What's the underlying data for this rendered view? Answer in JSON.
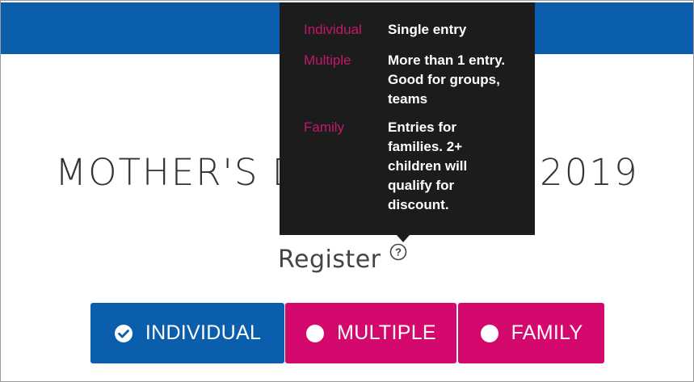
{
  "header": {
    "bar_color": "#0a5eab"
  },
  "event": {
    "title": "MOTHER'S DAY CLASSIC 2019"
  },
  "register": {
    "label": "Register",
    "help_icon": "question-circle-icon"
  },
  "tooltip": {
    "rows": [
      {
        "term": "Individual",
        "desc": "Single entry"
      },
      {
        "term": "Multiple",
        "desc": "More than 1 entry. Good for groups, teams"
      },
      {
        "term": "Family",
        "desc": "Entries for families. 2+ children will qualify for discount."
      }
    ],
    "term_color": "#c2186b",
    "background": "#1c1c1c"
  },
  "options": [
    {
      "label": "INDIVIDUAL",
      "selected": true,
      "icon": "check-circle-icon",
      "color": "#0a5eab"
    },
    {
      "label": "MULTIPLE",
      "selected": false,
      "icon": "radio-empty-icon",
      "color": "#d4096e"
    },
    {
      "label": "FAMILY",
      "selected": false,
      "icon": "radio-empty-icon",
      "color": "#d4096e"
    }
  ]
}
